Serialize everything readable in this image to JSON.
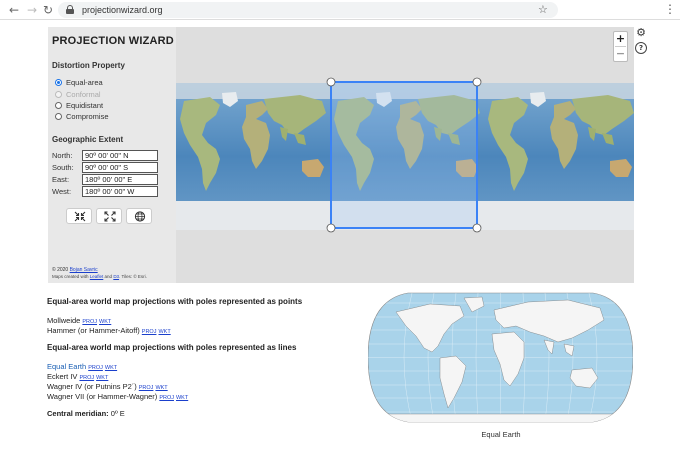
{
  "browser": {
    "url": "projectionwizard.org",
    "back_icon": "arrow-left",
    "forward_icon": "arrow-right",
    "reload_icon": "reload",
    "star_icon": "star",
    "menu_icon": "kebab"
  },
  "app": {
    "title": "PROJECTION WIZARD"
  },
  "distortion": {
    "title": "Distortion Property",
    "options": [
      {
        "label": "Equal-area",
        "selected": true,
        "enabled": true
      },
      {
        "label": "Conformal",
        "selected": false,
        "enabled": false
      },
      {
        "label": "Equidistant",
        "selected": false,
        "enabled": true
      },
      {
        "label": "Compromise",
        "selected": false,
        "enabled": true
      }
    ]
  },
  "extent": {
    "title": "Geographic Extent",
    "north": {
      "label": "North:",
      "value": "90º 00' 00\" N"
    },
    "south": {
      "label": "South:",
      "value": "90º 00' 00\" S"
    },
    "east": {
      "label": "East:",
      "value": "180º 00' 00\" E"
    },
    "west": {
      "label": "West:",
      "value": "180º 00' 00\" W"
    }
  },
  "tools": [
    "shrink-extent-icon",
    "expand-extent-icon",
    "globe-icon"
  ],
  "credits": {
    "line1_prefix": "© 2020 ",
    "line1_author": "Bojan Savric",
    "line2_prefix": "Maps created with ",
    "line2_leaflet": "Leaflet",
    "line2_and": " and ",
    "line2_d3": "D3",
    "line2_suffix": ". Tiles: © Esri."
  },
  "map_controls": {
    "zoom_in": "+",
    "zoom_out": "−",
    "settings_icon": "gear",
    "help_icon": "?"
  },
  "results": {
    "points_heading": "Equal-area world map projections with poles represented as points",
    "points_items": [
      {
        "name": "Mollweide",
        "proj": "PROJ",
        "wkt": "WKT"
      },
      {
        "name": "Hammer (or Hammer-Aitoff)",
        "proj": "PROJ",
        "wkt": "WKT"
      }
    ],
    "lines_heading": "Equal-area world map projections with poles represented as lines",
    "lines_items": [
      {
        "name": "Equal Earth",
        "proj": "PROJ",
        "wkt": "WKT",
        "highlighted": true
      },
      {
        "name": "Eckert IV",
        "proj": "PROJ",
        "wkt": "WKT"
      },
      {
        "name": "Wagner IV (or Putnins P2´)",
        "proj": "PROJ",
        "wkt": "WKT"
      },
      {
        "name": "Wagner VII (or Hammer-Wagner)",
        "proj": "PROJ",
        "wkt": "WKT"
      }
    ],
    "meridian_label": "Central meridian:",
    "meridian_value": " 0º E"
  },
  "preview": {
    "caption": "Equal Earth"
  },
  "colors": {
    "ocean": "#6b9ec9",
    "land": "#a8b87e",
    "ice": "#e6e9ec",
    "selection": "#3b82f6",
    "preview_ocean": "#a9d3ea",
    "link": "#1a3fcc"
  }
}
